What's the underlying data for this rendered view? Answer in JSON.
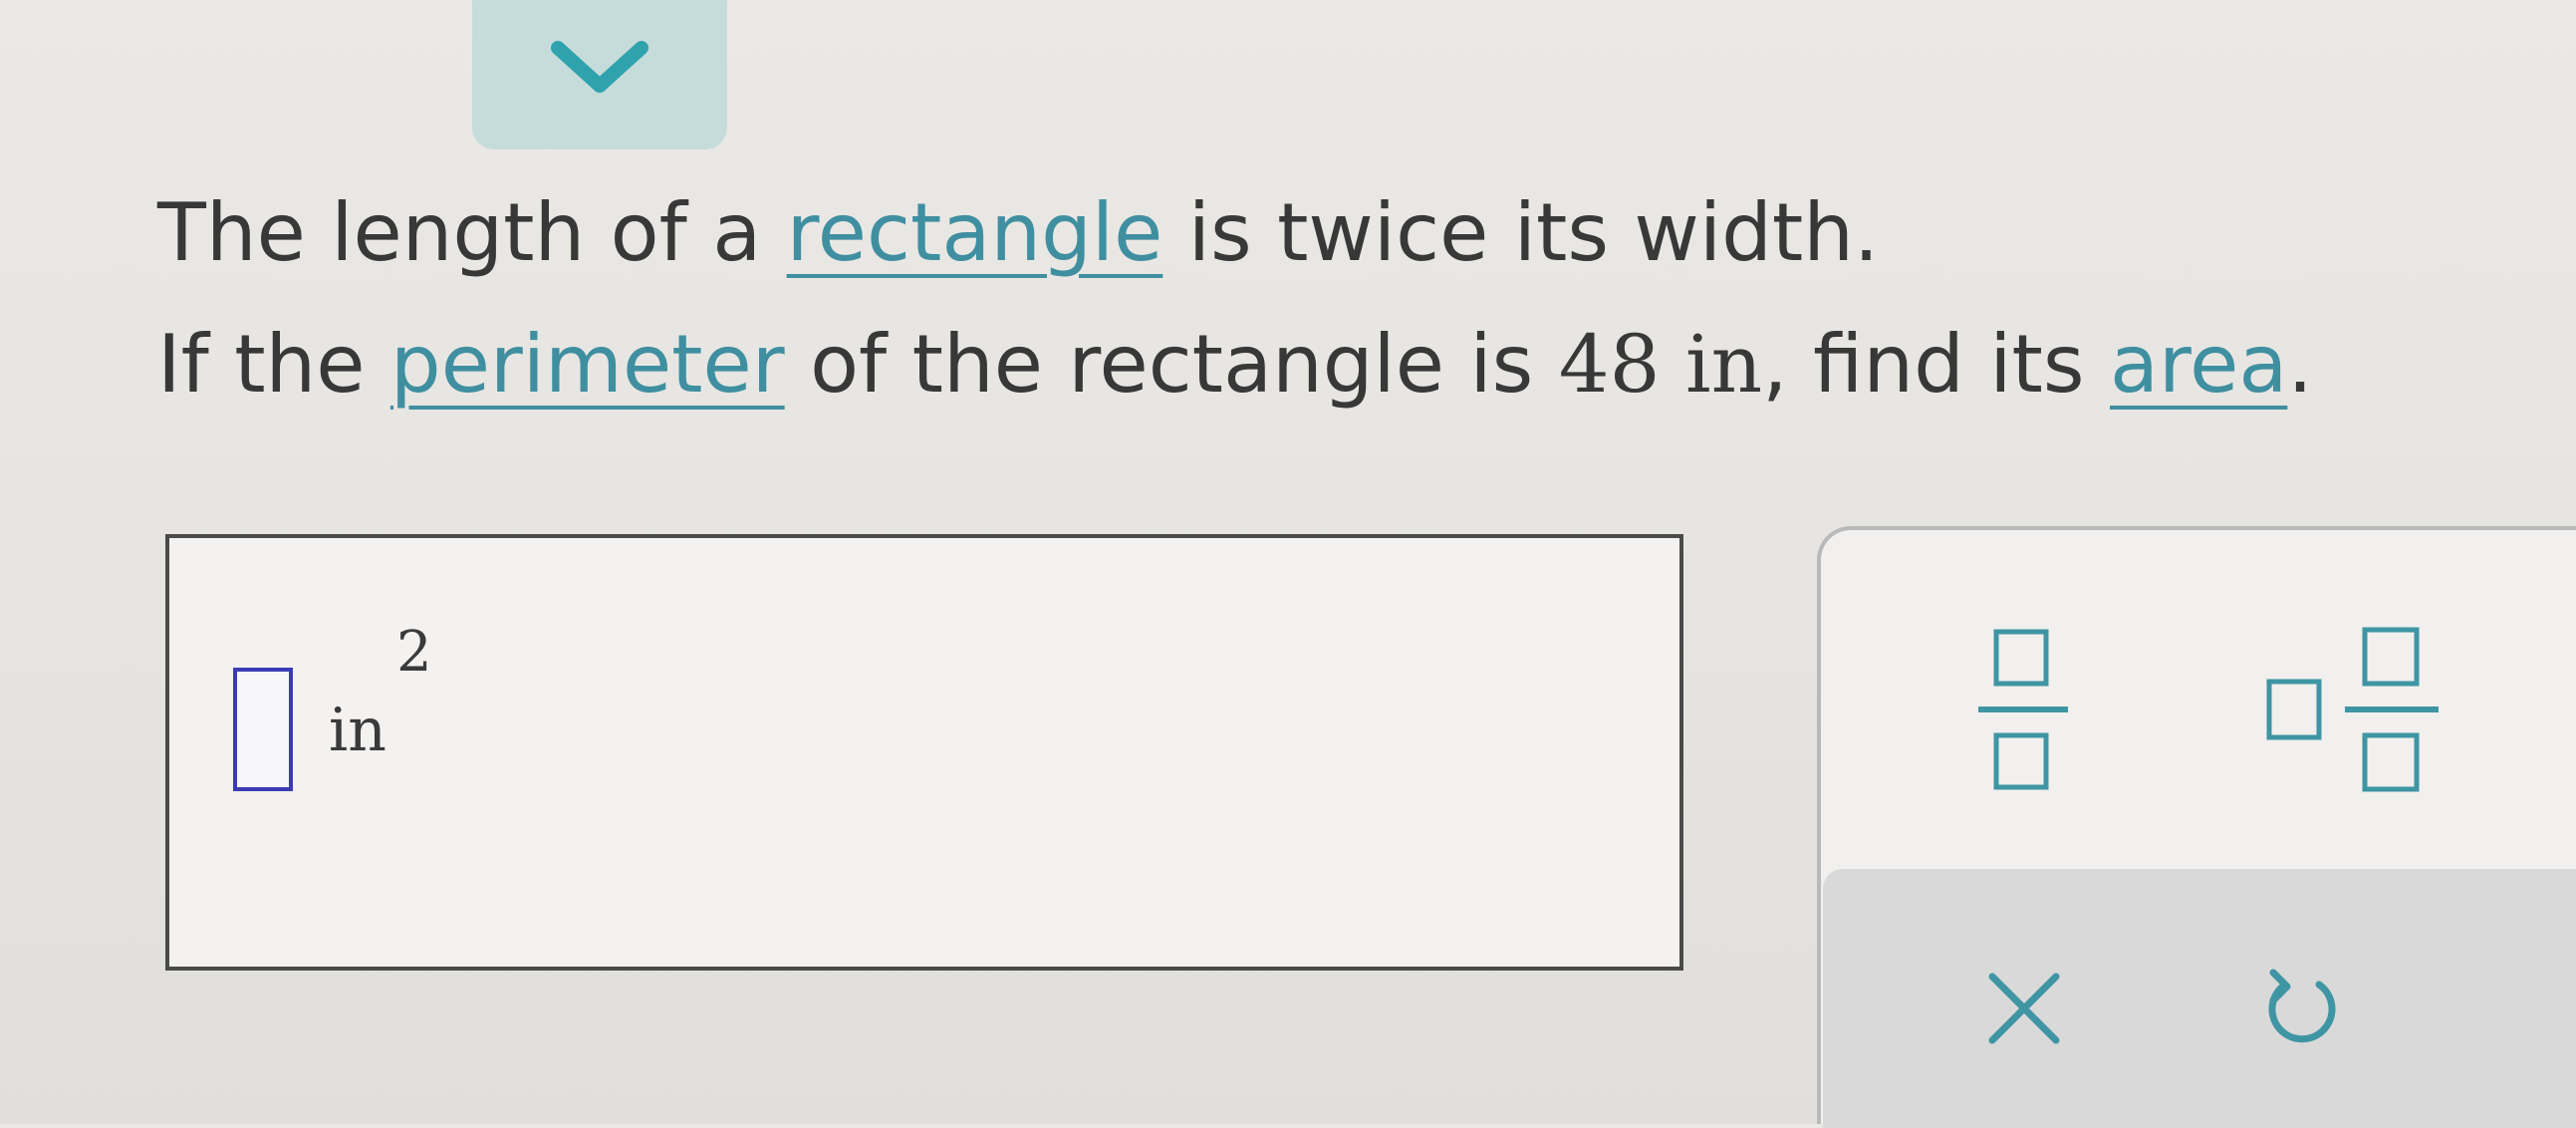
{
  "header": {
    "collapse_icon": "chevron-down-icon"
  },
  "question": {
    "line1": {
      "before": "The length of a ",
      "link": "rectangle",
      "after": " is twice its width."
    },
    "line2": {
      "before": "If the ",
      "link_perimeter": "perimeter",
      "middle": " of the rectangle is ",
      "value": "48",
      "unit": " in",
      "after_unit": ", find its ",
      "link_area": "area",
      "end": "."
    }
  },
  "answer": {
    "value": "",
    "unit_base": "in",
    "unit_exponent": "2"
  },
  "toolbar": {
    "tools": [
      {
        "name": "fraction",
        "icon": "fraction-icon"
      },
      {
        "name": "mixed-number",
        "icon": "mixed-number-icon"
      },
      {
        "name": "clear",
        "icon": "close-icon"
      },
      {
        "name": "undo",
        "icon": "undo-icon"
      }
    ]
  },
  "colors": {
    "link": "#3f8fa0",
    "tab_background": "#c6dcdb",
    "chevron": "#2fa3ad",
    "answer_slot_border": "#3b3bb8",
    "tool_icon": "#3f95a3",
    "tool_row_background": "#d9d9d9"
  }
}
